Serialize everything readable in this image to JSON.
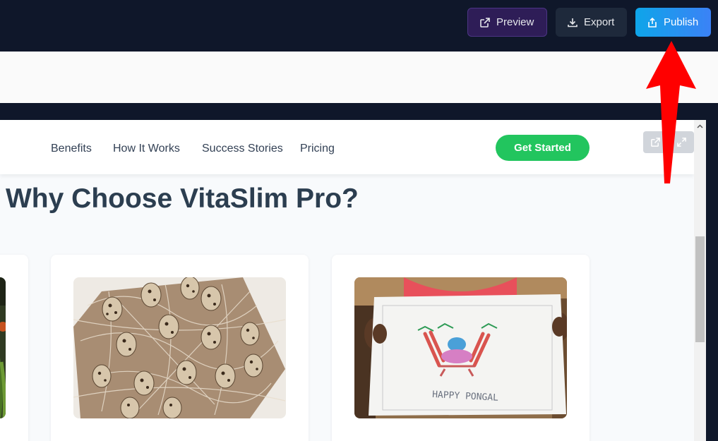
{
  "toolbar": {
    "preview_label": "Preview",
    "export_label": "Export",
    "publish_label": "Publish"
  },
  "site": {
    "nav": [
      "Benefits",
      "How It Works",
      "Success Stories",
      "Pricing"
    ],
    "cta_label": "Get Started",
    "heading": "Why Choose VitaSlim Pro?",
    "cards": [
      {
        "image": "vegetables-photo"
      },
      {
        "image": "quail-eggs-photo"
      },
      {
        "image": "happy-pongal-drawing-photo",
        "drawing_text": "HAPPY  PONGAL"
      }
    ]
  },
  "colors": {
    "toolbar_bg": "#0f172a",
    "preview_bg": "#2e1d57",
    "export_bg": "#1e293b",
    "publish_accent": "#0ea5e9",
    "cta_green": "#22c55e",
    "heading": "#2c3e50",
    "annotation_arrow": "#ff0000"
  },
  "icons": [
    "external-link-icon",
    "download-icon",
    "share-upload-icon",
    "expand-icon",
    "scroll-up-icon"
  ]
}
